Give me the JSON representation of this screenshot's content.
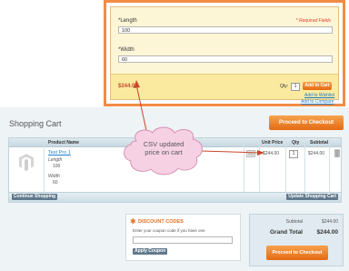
{
  "product_options": {
    "length_label": "*Length",
    "required_note": "* Required Fields",
    "length_value": "100",
    "width_label": "*Width",
    "width_value": "60",
    "price": "$244.00",
    "qty_label": "Qty:",
    "qty_value": "1",
    "add_to_cart_label": "Add to Cart",
    "add_to_wishlist_label": "Add to Wishlist",
    "add_to_compare_label": "Add to Compare"
  },
  "callout": {
    "line1": "CSV updated",
    "line2": "price on cart"
  },
  "cart": {
    "title": "Shopping Cart",
    "checkout_label": "Proceed to Checkout",
    "columns": {
      "product_name": "Product Name",
      "unit_price": "Unit Price",
      "qty": "Qty",
      "subtotal": "Subtotal"
    },
    "item": {
      "name": "Test Pro 1",
      "option1_label": "Length",
      "option1_value": "100",
      "option2_label": "Width",
      "option2_value": "60",
      "unit_price": "$244.00",
      "qty": "1",
      "subtotal": "$244.00"
    },
    "continue_label": "Continue Shopping",
    "update_label": "Update Shopping Cart"
  },
  "discount": {
    "title": "DISCOUNT CODES",
    "hint": "Enter your coupon code if you have one",
    "apply_label": "Apply Coupon"
  },
  "totals": {
    "subtotal_label": "Subtotal",
    "subtotal_value": "$244.00",
    "grand_label": "Grand Total",
    "grand_value": "$244.00",
    "checkout_label": "Proceed to Checkout"
  },
  "colors": {
    "accent_orange": "#f08c46",
    "link_blue": "#1e7ec8",
    "price_red": "#c8482b"
  }
}
